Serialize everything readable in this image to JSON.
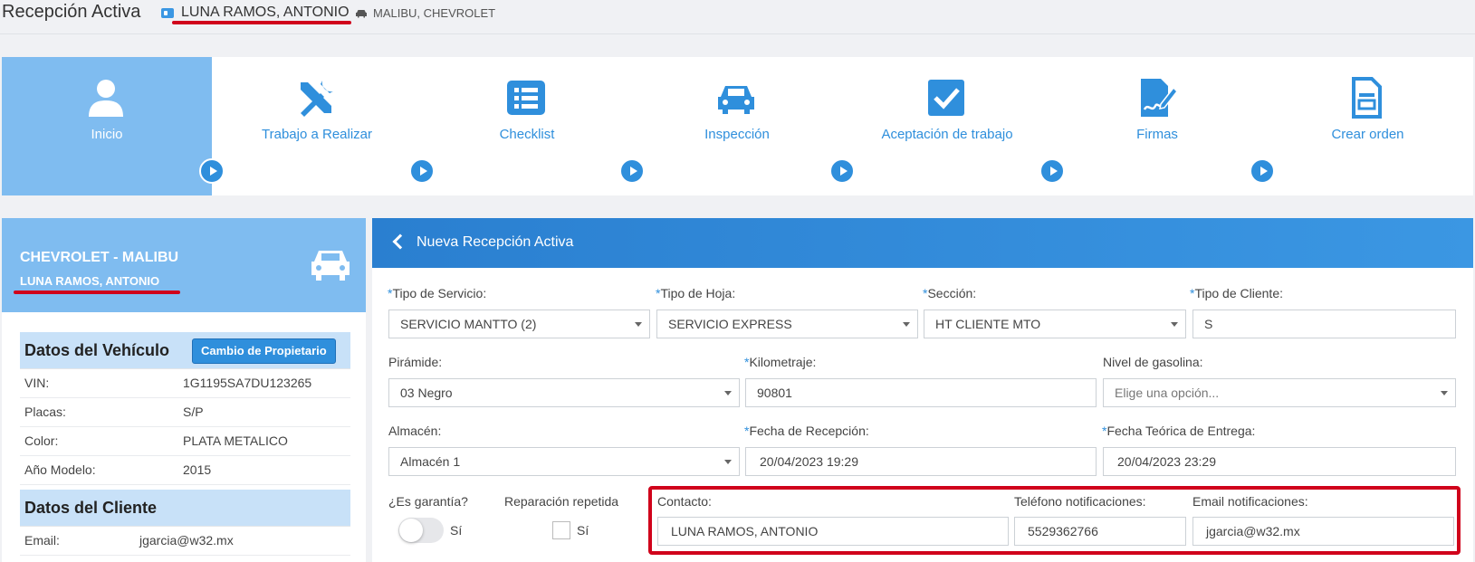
{
  "header": {
    "title": "Recepción Activa",
    "client_name": "LUNA RAMOS, ANTONIO",
    "vehicle": "MALIBU, CHEVROLET"
  },
  "steps": [
    {
      "label": "Inicio",
      "icon": "user-icon",
      "active": true
    },
    {
      "label": "Trabajo a Realizar",
      "icon": "tools-icon",
      "active": false
    },
    {
      "label": "Checklist",
      "icon": "list-icon",
      "active": false
    },
    {
      "label": "Inspección",
      "icon": "car-icon",
      "active": false
    },
    {
      "label": "Aceptación de trabajo",
      "icon": "check-icon",
      "active": false
    },
    {
      "label": "Firmas",
      "icon": "signature-icon",
      "active": false
    },
    {
      "label": "Crear orden",
      "icon": "document-icon",
      "active": false
    }
  ],
  "vehicle_panel": {
    "make_model": "CHEVROLET - MALIBU",
    "owner": "LUNA RAMOS, ANTONIO",
    "vehicle_section_title": "Datos del Vehículo",
    "change_owner_label": "Cambio de Propietario",
    "vehicle_rows": [
      {
        "label": "VIN:",
        "value": "1G1195SA7DU123265"
      },
      {
        "label": "Placas:",
        "value": "S/P"
      },
      {
        "label": "Color:",
        "value": "PLATA METALICO"
      },
      {
        "label": "Año Modelo:",
        "value": "2015"
      }
    ],
    "client_section_title": "Datos del Cliente",
    "client_rows": [
      {
        "label": "Email:",
        "value": "jgarcia@w32.mx"
      }
    ]
  },
  "form": {
    "title": "Nueva Recepción Activa",
    "tipo_servicio": {
      "label": "Tipo de Servicio:",
      "value": "SERVICIO MANTTO (2)"
    },
    "tipo_hoja": {
      "label": "Tipo de Hoja:",
      "value": "SERVICIO EXPRESS"
    },
    "seccion": {
      "label": "Sección:",
      "value": "HT CLIENTE MTO"
    },
    "tipo_cliente": {
      "label": "Tipo de Cliente:",
      "value": "S"
    },
    "piramide": {
      "label": "Pirámide:",
      "value": "03 Negro"
    },
    "kilometraje": {
      "label": "Kilometraje:",
      "value": "90801"
    },
    "nivel_gasolina": {
      "label": "Nivel de gasolina:",
      "placeholder": "Elige una opción..."
    },
    "almacen": {
      "label": "Almacén:",
      "value": "Almacén 1"
    },
    "fecha_recepcion": {
      "label": "Fecha de Recepción:",
      "value": "20/04/2023 19:29"
    },
    "fecha_entrega": {
      "label": "Fecha Teórica de Entrega:",
      "value": "20/04/2023 23:29"
    },
    "garantia": {
      "label": "¿Es garantía?",
      "option": "Sí"
    },
    "reparacion": {
      "label": "Reparación repetida",
      "option": "Sí"
    },
    "contacto": {
      "label": "Contacto:",
      "value": "LUNA RAMOS, ANTONIO"
    },
    "telefono": {
      "label": "Teléfono notificaciones:",
      "value": "5529362766"
    },
    "email": {
      "label": "Email notificaciones:",
      "value": "jgarcia@w32.mx"
    },
    "required_mark": "*"
  },
  "colors": {
    "accent": "#2f8fdc",
    "active_step": "#7fbcf0",
    "highlight": "#d0021b"
  }
}
